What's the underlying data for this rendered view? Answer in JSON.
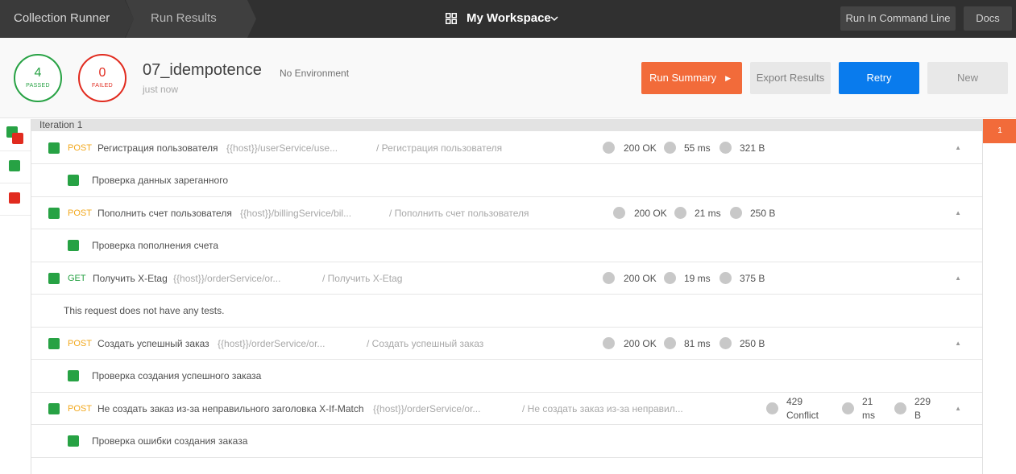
{
  "topbar": {
    "crumbs": [
      "Collection Runner",
      "Run Results"
    ],
    "workspace": "My Workspace",
    "icons": {
      "workspace": "grid-icon",
      "dropdown": "chevron-down-icon"
    },
    "run_cli_label": "Run In Command Line",
    "docs_label": "Docs"
  },
  "summary": {
    "passed_count": "4",
    "passed_label": "PASSED",
    "failed_count": "0",
    "failed_label": "FAILED",
    "run_name": "07_idempotence",
    "environment": "No Environment",
    "time": "just now",
    "buttons": {
      "summary": "Run Summary",
      "export": "Export Results",
      "retry": "Retry",
      "new": "New"
    }
  },
  "iteration": {
    "label": "Iteration 1",
    "tab": "1"
  },
  "requests": [
    {
      "method": "POST",
      "name": "Регистрация пользователя",
      "url": "{{host}}/userService/use...",
      "folder": "/ Регистрация пользователя",
      "status": "200 OK",
      "time": "55 ms",
      "size": "321 B",
      "test": "Проверка данных зареганного"
    },
    {
      "method": "POST",
      "name": "Пополнить счет пользователя",
      "url": "{{host}}/billingService/bil...",
      "folder": "/ Пополнить счет пользователя",
      "status": "200 OK",
      "time": "21 ms",
      "size": "250 B",
      "test": "Проверка пополнения счета"
    },
    {
      "method": "GET",
      "name": "Получить X-Etag",
      "url": "{{host}}/orderService/or...",
      "folder": "/ Получить X-Etag",
      "status": "200 OK",
      "time": "19 ms",
      "size": "375 B",
      "test": "This request does not have any tests."
    },
    {
      "method": "POST",
      "name": "Создать успешный заказ",
      "url": "{{host}}/orderService/or...",
      "folder": "/ Создать успешный заказ",
      "status": "200 OK",
      "time": "81 ms",
      "size": "250 B",
      "test": "Проверка создания успешного заказа"
    },
    {
      "method": "POST",
      "name": "Не создать заказ из-за неправильного заголовка X-If-Match",
      "url": "{{host}}/orderService/or...",
      "folder": "/ Не создать заказ из-за неправил...",
      "status_line1": "429",
      "status_line2": "Conflict",
      "time_line1": "21",
      "time_line2": "ms",
      "size_line1": "229",
      "size_line2": "B",
      "test": "Проверка ошибки создания заказа"
    }
  ],
  "colors": {
    "pass": "#27a244",
    "fail": "#e12b1f",
    "accent": "#f26b3a",
    "primary": "#097bed",
    "post": "#f2a81d",
    "topbar": "#303030"
  }
}
